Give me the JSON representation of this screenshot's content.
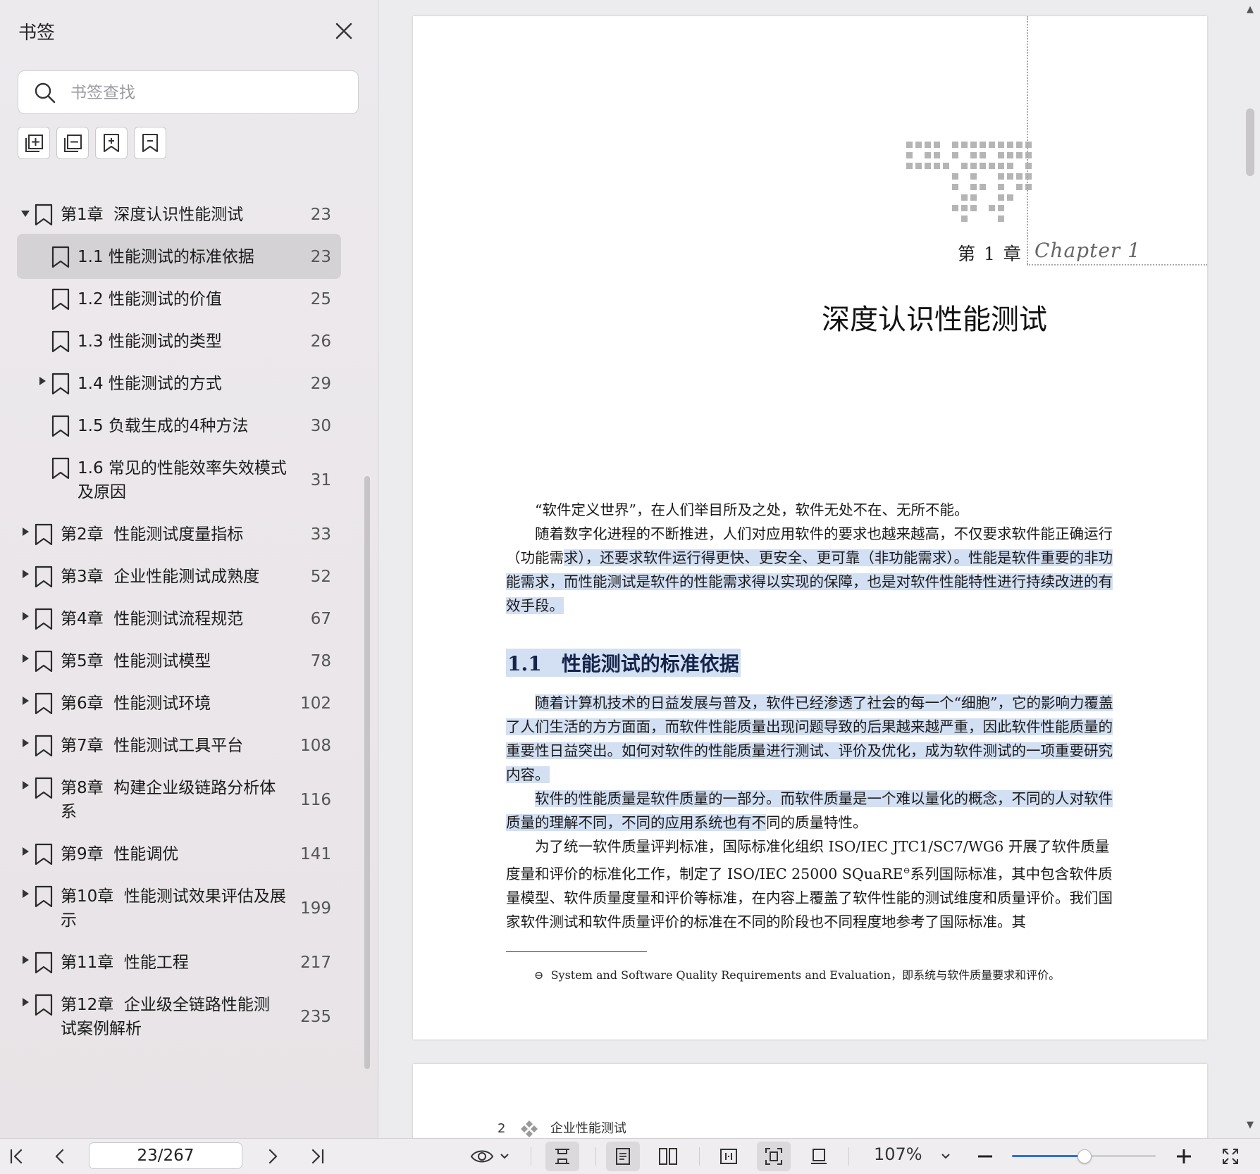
{
  "sidebar": {
    "title": "书签",
    "search_placeholder": "书签查找",
    "tools": [
      "expand-all-icon",
      "collapse-all-icon",
      "add-bookmark-icon",
      "remove-bookmark-icon"
    ],
    "bookmarks": [
      {
        "label": "第1章  深度认识性能测试",
        "page": "23",
        "level": 0,
        "arrow": "down"
      },
      {
        "label": "1.1 性能测试的标准依据",
        "page": "23",
        "level": 1,
        "arrow": "none",
        "selected": true
      },
      {
        "label": "1.2 性能测试的价值",
        "page": "25",
        "level": 1,
        "arrow": "none"
      },
      {
        "label": "1.3 性能测试的类型",
        "page": "26",
        "level": 1,
        "arrow": "none"
      },
      {
        "label": "1.4 性能测试的方式",
        "page": "29",
        "level": 1,
        "arrow": "right"
      },
      {
        "label": "1.5 负载生成的4种方法",
        "page": "30",
        "level": 1,
        "arrow": "none"
      },
      {
        "label": "1.6 常见的性能效率失效模式\n及原因",
        "page": "31",
        "level": 1,
        "arrow": "none"
      },
      {
        "label": "第2章  性能测试度量指标",
        "page": "33",
        "level": 0,
        "arrow": "right"
      },
      {
        "label": "第3章  企业性能测试成熟度",
        "page": "52",
        "level": 0,
        "arrow": "right"
      },
      {
        "label": "第4章  性能测试流程规范",
        "page": "67",
        "level": 0,
        "arrow": "right"
      },
      {
        "label": "第5章  性能测试模型",
        "page": "78",
        "level": 0,
        "arrow": "right"
      },
      {
        "label": "第6章  性能测试环境",
        "page": "102",
        "level": 0,
        "arrow": "right"
      },
      {
        "label": "第7章  性能测试工具平台",
        "page": "108",
        "level": 0,
        "arrow": "right"
      },
      {
        "label": "第8章  构建企业级链路分析体\n系",
        "page": "116",
        "level": 0,
        "arrow": "right"
      },
      {
        "label": "第9章  性能调优",
        "page": "141",
        "level": 0,
        "arrow": "right"
      },
      {
        "label": "第10章  性能测试效果评估及展\n示",
        "page": "199",
        "level": 0,
        "arrow": "right"
      },
      {
        "label": "第11章  性能工程",
        "page": "217",
        "level": 0,
        "arrow": "right"
      },
      {
        "label": "第12章  企业级全链路性能测\n试案例解析",
        "page": "235",
        "level": 0,
        "arrow": "right"
      }
    ]
  },
  "document": {
    "chapter_number": "第 1 章",
    "chapter_script": "Chapter 1",
    "chapter_title": "深度认识性能测试",
    "p1": "“软件定义世界”，在人们举目所及之处，软件无处不在、无所不能。",
    "p2_plain": "随着数字化进程的不断推进，人们对应用软件的要求也越来越高，不仅要求软件能正确运行（功能需",
    "p2_hl": "求），还要求软件运行得更快、更安全、更可靠（非功能需求）。性能是软件重要的非功能需求，而性能测试是软件的性能需求得以实现的保障，也是对软件性能特性进行持续改进的有效手段。",
    "section_title": "1.1　性能测试的标准依据",
    "p3_hl": "随着计算机技术的日益发展与普及，软件已经渗透了社会的每一个“细胞”，它的影响力覆盖了人们生活的方方面面，而软件性能质量出现问题导致的后果越来越严重，因此软件性能质量的重要性日益突出。如何对软件的性能质量进行测试、评价及优化，成为软件测试的一项重要研究内容。",
    "p4_hl": "软件的性能质量是软件质量的一部分。而软件质量是一个难以量化的概念，不同的人对软件质量的理解不同，不同的应用系统也有不",
    "p4_plain": "同的质量特性。",
    "p5": "为了统一软件质量评判标准，国际标准化组织 ISO/IEC JTC1/SC7/WG6 开展了软件质量度量和评价的标准化工作，制定了 ISO/IEC 25000 SQuaRE",
    "p5_sup": "⊖",
    "p5_tail": "系列国际标准，其中包含软件质量模型、软件质量度量和评价等标准，在内容上覆盖了软件性能的测试维度和质量评价。我们国家软件测试和软件质量评价的标准在不同的阶段也不同程度地参考了国际标准。其",
    "footnote_mark": "⊖",
    "footnote": "System and Software Quality Requirements and Evaluation，即系统与软件质量要求和评价。",
    "page2_number": "2",
    "page2_header": "企业性能测试"
  },
  "toolbar": {
    "page_value": "23/267",
    "zoom": "107%",
    "zoom_fraction": 0.5
  }
}
